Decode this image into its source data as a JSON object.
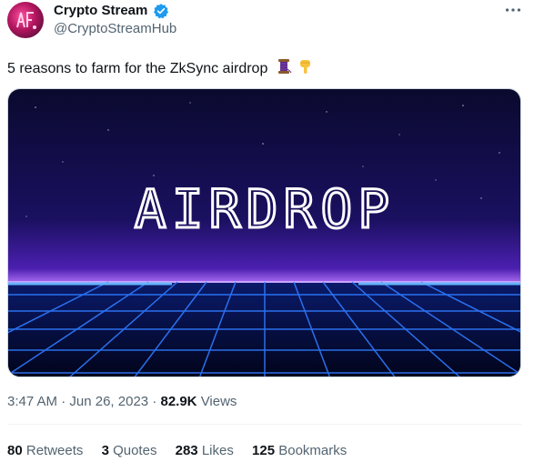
{
  "author": {
    "display_name": "Crypto Stream",
    "handle": "@CryptoStreamHub",
    "verified": true
  },
  "tweet": {
    "text": "5 reasons to farm for the ZkSync airdrop",
    "emojis": [
      "spool-of-thread-icon",
      "backhand-index-pointing-down-icon"
    ],
    "media": {
      "headline": "AIRDROP"
    }
  },
  "meta": {
    "time": "3:47 AM",
    "separator1": "·",
    "date": "Jun 26, 2023",
    "separator2": "·",
    "views_count": "82.9K",
    "views_label": "Views"
  },
  "stats": [
    {
      "count": "80",
      "label": "Retweets"
    },
    {
      "count": "3",
      "label": "Quotes"
    },
    {
      "count": "283",
      "label": "Likes"
    },
    {
      "count": "125",
      "label": "Bookmarks"
    }
  ],
  "colors": {
    "accent_verified": "#1d9bf0",
    "secondary_text": "#536471",
    "primary_text": "#0f1419"
  }
}
